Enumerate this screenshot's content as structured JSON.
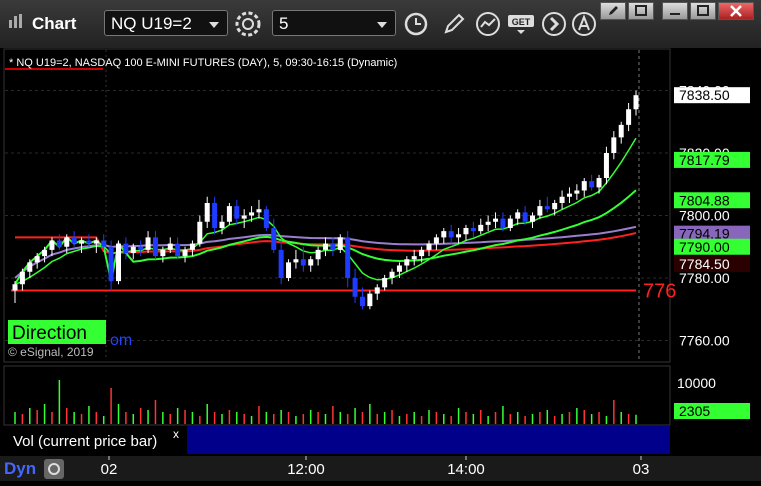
{
  "app": {
    "title": "Chart"
  },
  "toolbar": {
    "symbol": "NQ U19=2",
    "interval": "5"
  },
  "chart_header": "* NQ U19=2, NASDAQ 100 E-MINI FUTURES (DAY), 5, 09:30-16:15 (Dynamic)",
  "watermark": "© eSignal, 2019",
  "banner": {
    "direction": "Direction",
    "partial": "om",
    "red_partial": "776"
  },
  "price_axis": {
    "ticks": [
      "7840.00",
      "7820.00",
      "7800.00",
      "7780.00",
      "7760.00"
    ],
    "badges": [
      {
        "label": "7838.50",
        "bg": "#ffffff",
        "fg": "#000000"
      },
      {
        "label": "7817.79",
        "bg": "#33ff33",
        "fg": "#000000"
      },
      {
        "label": "7804.88",
        "bg": "#33ff33",
        "fg": "#000000"
      },
      {
        "label": "7794.19",
        "bg": "#8866bb",
        "fg": "#000000"
      },
      {
        "label": "7790.00",
        "bg": "#33ff33",
        "fg": "#000000"
      },
      {
        "label": "7784.50",
        "bg": "#2a0000",
        "fg": "#ffffff"
      }
    ]
  },
  "volume": {
    "tick": "10000",
    "badge": "2305",
    "label": "Vol (current price bar)",
    "close_glyph": "x"
  },
  "time_axis": [
    "02",
    "12:00",
    "14:00",
    "03"
  ],
  "status_bar": {
    "mode": "Dyn"
  },
  "colors": {
    "up": "#ffffff",
    "down": "#1e3cff",
    "ema_fast": "#33ff33",
    "vwap": "#ff2020",
    "avg": "#9a7fd0",
    "volume_up": "#33ff33",
    "volume_down": "#ff3333"
  },
  "chart_data": {
    "type": "candlestick",
    "ylim": [
      7756,
      7844
    ],
    "support_level": 7776,
    "candles": [
      [
        7776,
        7779,
        7772,
        7778
      ],
      [
        7778,
        7783,
        7776,
        7782
      ],
      [
        7782,
        7786,
        7780,
        7785
      ],
      [
        7785,
        7788,
        7783,
        7787
      ],
      [
        7787,
        7790,
        7785,
        7789
      ],
      [
        7789,
        7793,
        7787,
        7792
      ],
      [
        7792,
        7794,
        7789,
        7790
      ],
      [
        7790,
        7794,
        7788,
        7793
      ],
      [
        7793,
        7795,
        7790,
        7791
      ],
      [
        7791,
        7793,
        7788,
        7792
      ],
      [
        7792,
        7794,
        7790,
        7791
      ],
      [
        7791,
        7793,
        7788,
        7792
      ],
      [
        7792,
        7794,
        7789,
        7790
      ],
      [
        7790,
        7792,
        7776,
        7779
      ],
      [
        7779,
        7792,
        7778,
        7791
      ],
      [
        7791,
        7793,
        7786,
        7788
      ],
      [
        7788,
        7791,
        7786,
        7790
      ],
      [
        7790,
        7792,
        7787,
        7789
      ],
      [
        7789,
        7795,
        7788,
        7793
      ],
      [
        7793,
        7795,
        7786,
        7787
      ],
      [
        7787,
        7790,
        7785,
        7789
      ],
      [
        7789,
        7793,
        7788,
        7791
      ],
      [
        7791,
        7793,
        7786,
        7787
      ],
      [
        7787,
        7790,
        7785,
        7789
      ],
      [
        7789,
        7792,
        7787,
        7791
      ],
      [
        7791,
        7800,
        7790,
        7798
      ],
      [
        7798,
        7806,
        7796,
        7804
      ],
      [
        7804,
        7806,
        7794,
        7796
      ],
      [
        7796,
        7800,
        7794,
        7798
      ],
      [
        7798,
        7804,
        7797,
        7803
      ],
      [
        7803,
        7805,
        7797,
        7799
      ],
      [
        7799,
        7802,
        7796,
        7800
      ],
      [
        7800,
        7803,
        7798,
        7801
      ],
      [
        7801,
        7805,
        7799,
        7802
      ],
      [
        7802,
        7803,
        7795,
        7796
      ],
      [
        7796,
        7799,
        7788,
        7789
      ],
      [
        7789,
        7792,
        7778,
        7780
      ],
      [
        7780,
        7786,
        7779,
        7785
      ],
      [
        7785,
        7789,
        7783,
        7786
      ],
      [
        7786,
        7790,
        7782,
        7784
      ],
      [
        7784,
        7787,
        7782,
        7786
      ],
      [
        7786,
        7790,
        7784,
        7789
      ],
      [
        7789,
        7793,
        7787,
        7791
      ],
      [
        7791,
        7793,
        7787,
        7789
      ],
      [
        7789,
        7794,
        7788,
        7793
      ],
      [
        7793,
        7795,
        7777,
        7780
      ],
      [
        7780,
        7783,
        7772,
        7774
      ],
      [
        7774,
        7777,
        7770,
        7771
      ],
      [
        7771,
        7776,
        7770,
        7775
      ],
      [
        7775,
        7778,
        7773,
        7777
      ],
      [
        7777,
        7781,
        7776,
        7780
      ],
      [
        7780,
        7783,
        7778,
        7782
      ],
      [
        7782,
        7785,
        7780,
        7784
      ],
      [
        7784,
        7787,
        7782,
        7786
      ],
      [
        7786,
        7789,
        7784,
        7787
      ],
      [
        7787,
        7790,
        7785,
        7789
      ],
      [
        7789,
        7792,
        7787,
        7791
      ],
      [
        7791,
        7794,
        7789,
        7793
      ],
      [
        7793,
        7796,
        7791,
        7795
      ],
      [
        7795,
        7797,
        7791,
        7793
      ],
      [
        7793,
        7796,
        7791,
        7794
      ],
      [
        7794,
        7797,
        7792,
        7796
      ],
      [
        7796,
        7798,
        7793,
        7795
      ],
      [
        7795,
        7799,
        7794,
        7797
      ],
      [
        7797,
        7800,
        7795,
        7798
      ],
      [
        7798,
        7801,
        7796,
        7799
      ],
      [
        7799,
        7801,
        7795,
        7796
      ],
      [
        7796,
        7800,
        7795,
        7799
      ],
      [
        7799,
        7802,
        7797,
        7801
      ],
      [
        7801,
        7803,
        7797,
        7798
      ],
      [
        7798,
        7801,
        7796,
        7800
      ],
      [
        7800,
        7805,
        7799,
        7803
      ],
      [
        7803,
        7806,
        7801,
        7802
      ],
      [
        7802,
        7805,
        7800,
        7804
      ],
      [
        7804,
        7808,
        7802,
        7806
      ],
      [
        7806,
        7809,
        7804,
        7807
      ],
      [
        7807,
        7810,
        7805,
        7808
      ],
      [
        7808,
        7812,
        7806,
        7811
      ],
      [
        7811,
        7813,
        7808,
        7809
      ],
      [
        7809,
        7813,
        7807,
        7812
      ],
      [
        7812,
        7822,
        7810,
        7820
      ],
      [
        7820,
        7827,
        7818,
        7825
      ],
      [
        7825,
        7830,
        7823,
        7829
      ],
      [
        7829,
        7836,
        7827,
        7834
      ],
      [
        7834,
        7840,
        7832,
        7838.5
      ]
    ],
    "volume": [
      [
        false,
        3000
      ],
      [
        true,
        2500
      ],
      [
        false,
        4000
      ],
      [
        true,
        3500
      ],
      [
        false,
        5000
      ],
      [
        true,
        3000
      ],
      [
        false,
        11000
      ],
      [
        true,
        4000
      ],
      [
        false,
        3000
      ],
      [
        true,
        2500
      ],
      [
        false,
        4500
      ],
      [
        true,
        3000
      ],
      [
        false,
        2000
      ],
      [
        true,
        9000
      ],
      [
        false,
        5000
      ],
      [
        true,
        3000
      ],
      [
        false,
        2500
      ],
      [
        true,
        4000
      ],
      [
        false,
        3500
      ],
      [
        true,
        6000
      ],
      [
        false,
        3000
      ],
      [
        true,
        2500
      ],
      [
        false,
        4000
      ],
      [
        true,
        3500
      ],
      [
        false,
        3000
      ],
      [
        true,
        2000
      ],
      [
        false,
        5000
      ],
      [
        true,
        3000
      ],
      [
        false,
        2500
      ],
      [
        true,
        3500
      ],
      [
        false,
        3000
      ],
      [
        true,
        2500
      ],
      [
        false,
        2000
      ],
      [
        true,
        4500
      ],
      [
        false,
        3000
      ],
      [
        true,
        2500
      ],
      [
        false,
        3500
      ],
      [
        true,
        3000
      ],
      [
        false,
        2000
      ],
      [
        true,
        2500
      ],
      [
        false,
        3500
      ],
      [
        true,
        3000
      ],
      [
        false,
        2500
      ],
      [
        true,
        4500
      ],
      [
        false,
        3000
      ],
      [
        true,
        2500
      ],
      [
        false,
        4000
      ],
      [
        true,
        3000
      ],
      [
        false,
        5000
      ],
      [
        true,
        2500
      ],
      [
        false,
        3000
      ],
      [
        true,
        3500
      ],
      [
        false,
        2000
      ],
      [
        true,
        2500
      ],
      [
        false,
        3000
      ],
      [
        true,
        2000
      ],
      [
        false,
        3500
      ],
      [
        true,
        3000
      ],
      [
        false,
        2500
      ],
      [
        true,
        2000
      ],
      [
        false,
        4000
      ],
      [
        true,
        3000
      ],
      [
        false,
        2500
      ],
      [
        true,
        3500
      ],
      [
        false,
        2000
      ],
      [
        true,
        3000
      ],
      [
        false,
        4500
      ],
      [
        true,
        2500
      ],
      [
        false,
        3000
      ],
      [
        true,
        2000
      ],
      [
        false,
        2500
      ],
      [
        true,
        3000
      ],
      [
        false,
        3500
      ],
      [
        true,
        2000
      ],
      [
        false,
        2500
      ],
      [
        true,
        3000
      ],
      [
        false,
        4000
      ],
      [
        true,
        3500
      ],
      [
        false,
        2500
      ],
      [
        true,
        3000
      ],
      [
        false,
        2000
      ],
      [
        true,
        6000
      ],
      [
        false,
        3000
      ],
      [
        true,
        2500
      ],
      [
        false,
        2305
      ]
    ],
    "volume_ylim": [
      0,
      14000
    ]
  }
}
